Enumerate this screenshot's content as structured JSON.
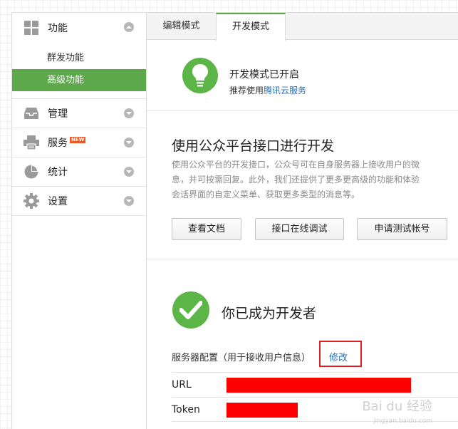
{
  "sidebar": {
    "groups": [
      {
        "label": "功能",
        "icon": "grid-icon",
        "expanded": true,
        "items": [
          {
            "label": "群发功能"
          },
          {
            "label": "高级功能",
            "active": true
          }
        ]
      },
      {
        "label": "管理",
        "icon": "inbox-icon"
      },
      {
        "label": "服务",
        "icon": "printer-icon",
        "badge": "NEW"
      },
      {
        "label": "统计",
        "icon": "pie-chart-icon"
      },
      {
        "label": "设置",
        "icon": "gear-icon"
      }
    ]
  },
  "tabs": {
    "edit": "编辑模式",
    "dev": "开发模式"
  },
  "hero": {
    "title": "开发模式已开启",
    "sub_prefix": "推荐使用",
    "sub_link": "腾讯云服务"
  },
  "dev": {
    "title": "使用公众平台接口进行开发",
    "desc_lines": [
      "使用公众平台的开发接口，公众号可在自身服务器上接收用户的微",
      "息，并可按需回复。此外，我们还提供了更多更高级的功能和体验",
      "会话界面的自定义菜单、获取更多类型的消息等。"
    ],
    "buttons": {
      "doc": "查看文档",
      "debug": "接口在线调试",
      "test": "申请测试帐号"
    }
  },
  "done": {
    "title": "你已成为开发者",
    "config_label": "服务器配置（用于接收用户信息）",
    "modify": "修改",
    "url_label": "URL",
    "token_label": "Token"
  },
  "watermark": {
    "main": "Bai du 经验",
    "sub": "jingyan.baidu.com"
  },
  "colors": {
    "accent_green": "#5ca84b",
    "link_blue": "#2c6fb4",
    "redact_red": "#ff0000",
    "highlight_red": "#e02020"
  }
}
